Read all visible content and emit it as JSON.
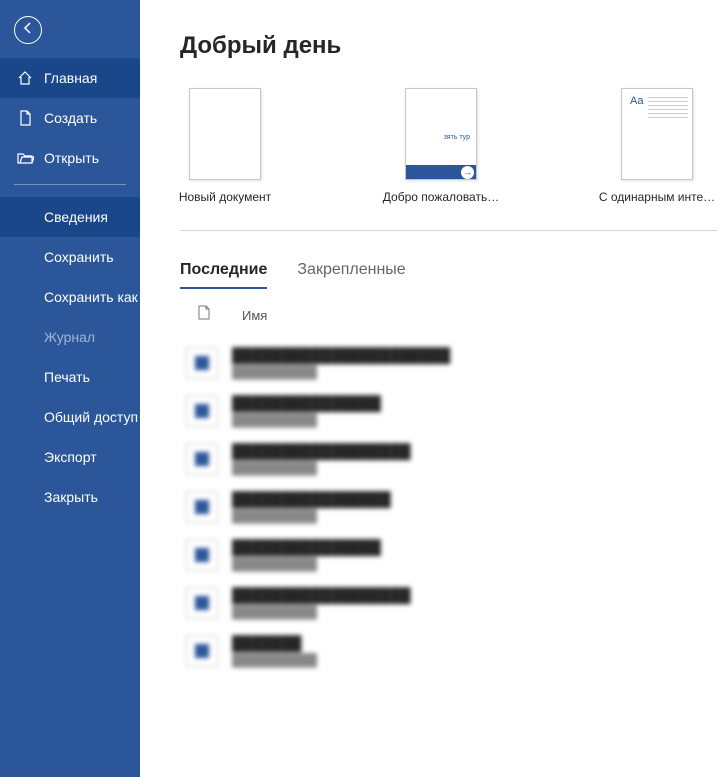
{
  "greeting": "Добрый день",
  "sidebar": {
    "primary": [
      {
        "label": "Главная",
        "icon": "home-icon",
        "selected": true
      },
      {
        "label": "Создать",
        "icon": "new-doc-icon",
        "selected": false
      },
      {
        "label": "Открыть",
        "icon": "open-folder-icon",
        "selected": false
      }
    ],
    "secondary": [
      {
        "label": "Сведения",
        "active": true
      },
      {
        "label": "Сохранить"
      },
      {
        "label": "Сохранить как"
      },
      {
        "label": "Журнал",
        "dim": true
      },
      {
        "label": "Печать"
      },
      {
        "label": "Общий доступ"
      },
      {
        "label": "Экспорт"
      },
      {
        "label": "Закрыть"
      }
    ]
  },
  "templates": [
    {
      "label": "Новый документ",
      "kind": "blank"
    },
    {
      "label": "Добро пожаловать…",
      "kind": "welcome",
      "inner_text": "зять тур"
    },
    {
      "label": "С одинарным инте…",
      "kind": "single",
      "aa": "Aa"
    }
  ],
  "tabs": [
    {
      "label": "Последние",
      "active": true
    },
    {
      "label": "Закрепленные",
      "active": false
    }
  ],
  "columns": {
    "name_header": "Имя"
  },
  "recent_docs": [
    {
      "name": "██████████████████████",
      "path": "██████████"
    },
    {
      "name": "███████████████",
      "path": "██████████"
    },
    {
      "name": "██████████████████",
      "path": "██████████"
    },
    {
      "name": "████████████████",
      "path": "██████████"
    },
    {
      "name": "███████████████",
      "path": "██████████"
    },
    {
      "name": "██████████████████",
      "path": "██████████"
    },
    {
      "name": "███████",
      "path": "██████████"
    }
  ]
}
